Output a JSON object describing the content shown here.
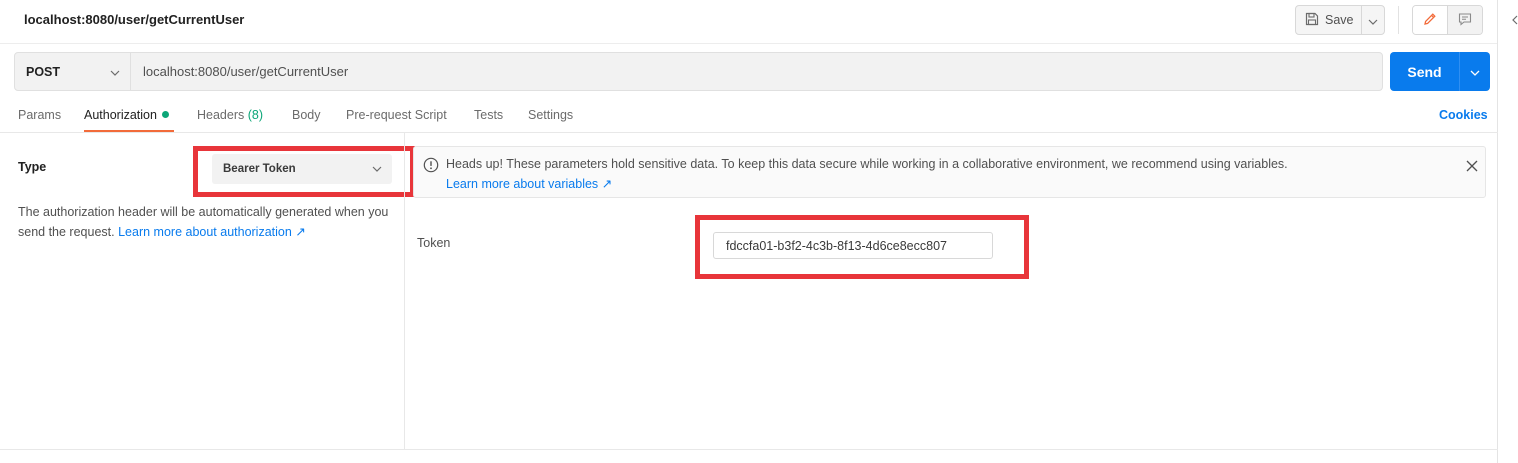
{
  "request": {
    "title": "localhost:8080/user/getCurrentUser",
    "method": "POST",
    "url": "localhost:8080/user/getCurrentUser"
  },
  "toolbar": {
    "save_label": "Save",
    "send_label": "Send"
  },
  "tabs": [
    {
      "label": "Params"
    },
    {
      "label": "Authorization",
      "active": true
    },
    {
      "label": "Headers",
      "count": "(8)"
    },
    {
      "label": "Body"
    },
    {
      "label": "Pre-request Script"
    },
    {
      "label": "Tests"
    },
    {
      "label": "Settings"
    }
  ],
  "cookies_label": "Cookies",
  "auth": {
    "type_label": "Type",
    "type_value": "Bearer Token",
    "description": "The authorization header will be automatically generated when you send the request.",
    "description_link": "Learn more about authorization ↗",
    "notice_text": "Heads up! These parameters hold sensitive data. To keep this data secure while working in a collaborative environment, we recommend using variables.",
    "notice_link": "Learn more about variables ↗",
    "token_label": "Token",
    "token_value": "fdccfa01-b3f2-4c3b-8f13-4d6ce8ecc807"
  },
  "colors": {
    "accent_blue": "#097bed",
    "active_tab_underline": "#f26b3a",
    "status_dot": "#0ca678",
    "highlight_box": "#e8353a"
  }
}
